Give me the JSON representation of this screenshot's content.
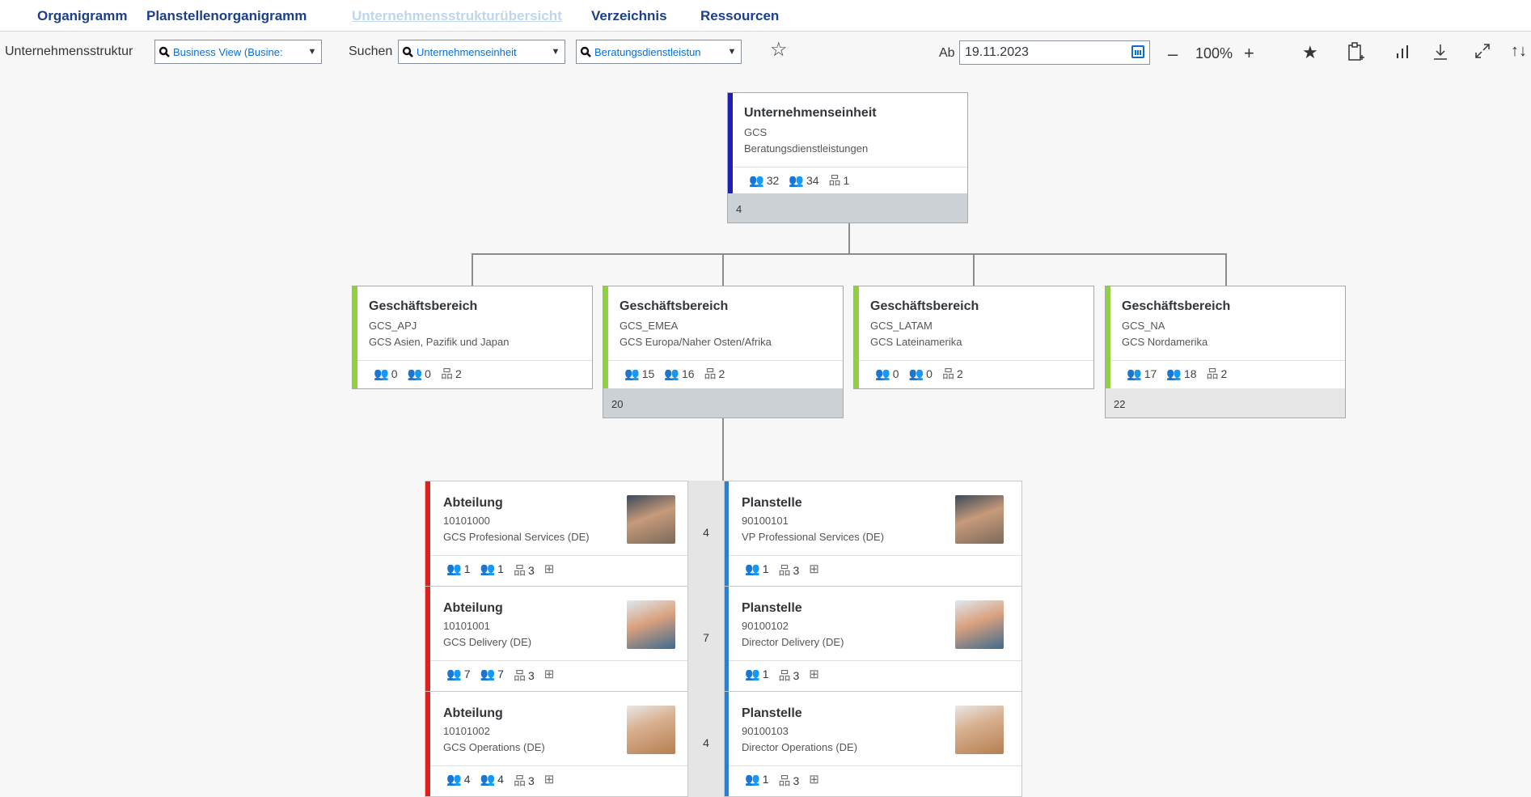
{
  "nav": {
    "tabs": [
      {
        "label": "Organigramm"
      },
      {
        "label": "Planstellenorganigramm"
      },
      {
        "label": "Unternehmensstrukturübersicht",
        "active": true
      },
      {
        "label": "Verzeichnis"
      },
      {
        "label": "Ressourcen"
      }
    ]
  },
  "toolbar": {
    "structure_label": "Unternehmensstruktur",
    "structure_value": "Business View (Busine:",
    "search_label": "Suchen",
    "search_type_value": "Unternehmenseinheit",
    "search_value": "Beratungsdienstleistun",
    "date_label": "Ab",
    "date_value": "19.11.2023",
    "zoom_minus": "–",
    "zoom_level": "100%",
    "zoom_plus": "+",
    "accent_color": "#0a6ed1"
  },
  "root": {
    "title": "Unternehmenseinheit",
    "code": "GCS",
    "name": "Beratungsdienstleistungen",
    "s1": "32",
    "s2": "34",
    "s3": "1",
    "footer": "4",
    "accent": "#1f1fb5"
  },
  "divisions": [
    {
      "title": "Geschäftsbereich",
      "code": "GCS_APJ",
      "name": "GCS Asien, Pazifik und Japan",
      "s1": "0",
      "s2": "0",
      "s3": "2",
      "footer": "",
      "accent": "#8fd13f"
    },
    {
      "title": "Geschäftsbereich",
      "code": "GCS_EMEA",
      "name": "GCS Europa/Naher Osten/Afrika",
      "s1": "15",
      "s2": "16",
      "s3": "2",
      "footer": "20",
      "accent": "#8fd13f"
    },
    {
      "title": "Geschäftsbereich",
      "code": "GCS_LATAM",
      "name": "GCS Lateinamerika",
      "s1": "0",
      "s2": "0",
      "s3": "2",
      "footer": "",
      "accent": "#8fd13f"
    },
    {
      "title": "Geschäftsbereich",
      "code": "GCS_NA",
      "name": "GCS Nordamerika",
      "s1": "17",
      "s2": "18",
      "s3": "2",
      "footer": "22",
      "accent": "#8fd13f"
    }
  ],
  "rows": [
    {
      "dept": {
        "title": "Abteilung",
        "code": "10101000",
        "name": "GCS Profesional Services (DE)",
        "s1": "1",
        "s2": "1",
        "s3": "3"
      },
      "count": "4",
      "pos": {
        "title": "Planstelle",
        "code": "90100101",
        "name": "VP Professional Services (DE)",
        "s1": "1",
        "s3": "3"
      }
    },
    {
      "dept": {
        "title": "Abteilung",
        "code": "10101001",
        "name": "GCS Delivery (DE)",
        "s1": "7",
        "s2": "7",
        "s3": "3"
      },
      "count": "7",
      "pos": {
        "title": "Planstelle",
        "code": "90100102",
        "name": "Director Delivery (DE)",
        "s1": "1",
        "s3": "3"
      }
    },
    {
      "dept": {
        "title": "Abteilung",
        "code": "10101002",
        "name": "GCS Operations (DE)",
        "s1": "4",
        "s2": "4",
        "s3": "3"
      },
      "count": "4",
      "pos": {
        "title": "Planstelle",
        "code": "90100103",
        "name": "Director Operations (DE)",
        "s1": "1",
        "s3": "3"
      }
    }
  ],
  "colors": {
    "dept_accent": "#e0201c",
    "pos_accent": "#2f7ec7"
  }
}
